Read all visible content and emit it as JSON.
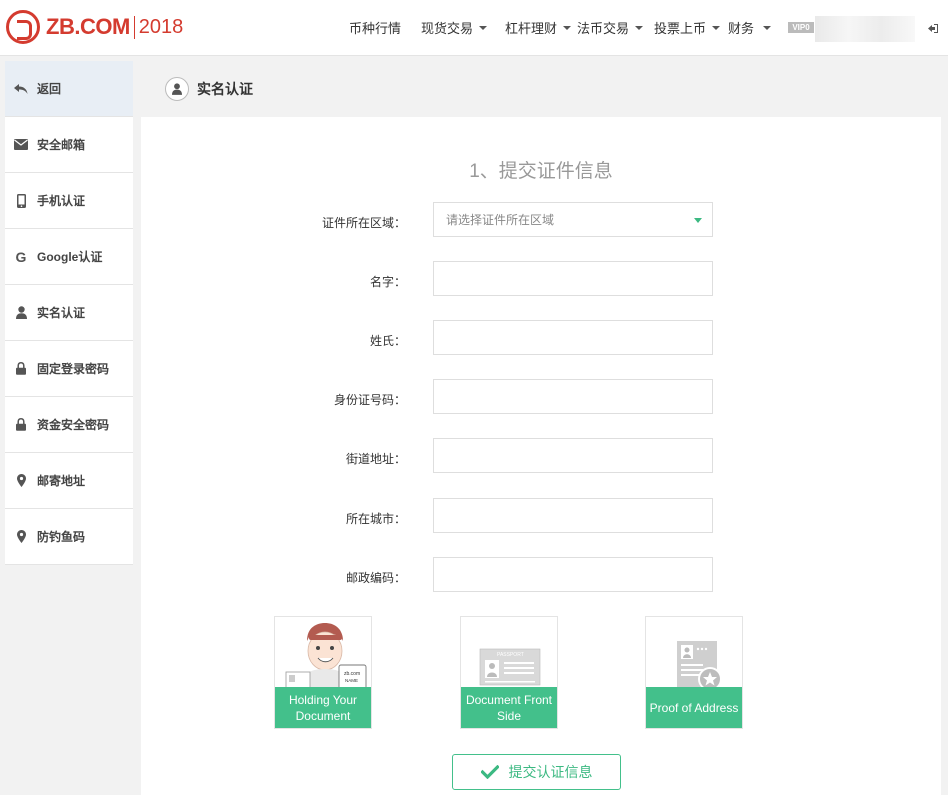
{
  "header": {
    "logo_text": "ZB.COM",
    "logo_year": "2018",
    "nav": [
      {
        "label": "币种行情",
        "dropdown": false
      },
      {
        "label": "现货交易",
        "dropdown": true
      },
      {
        "label": "杠杆理财",
        "dropdown": true
      },
      {
        "label": "法币交易",
        "dropdown": true
      },
      {
        "label": "投票上币",
        "dropdown": true
      },
      {
        "label": "财务",
        "dropdown": true
      }
    ],
    "vip_badge": "VIP0"
  },
  "sidebar": {
    "items": [
      {
        "label": "返回",
        "icon": "back-arrow-icon",
        "active": true
      },
      {
        "label": "安全邮箱",
        "icon": "envelope-icon"
      },
      {
        "label": "手机认证",
        "icon": "mobile-icon"
      },
      {
        "label": "Google认证",
        "icon": "google-icon"
      },
      {
        "label": "实名认证",
        "icon": "user-icon"
      },
      {
        "label": "固定登录密码",
        "icon": "lock-icon"
      },
      {
        "label": "资金安全密码",
        "icon": "lock-icon"
      },
      {
        "label": "邮寄地址",
        "icon": "map-marker-icon"
      },
      {
        "label": "防钓鱼码",
        "icon": "map-marker-icon"
      }
    ]
  },
  "page": {
    "title": "实名认证",
    "step_title": "1、提交证件信息"
  },
  "form": {
    "region_label": "证件所在区域：",
    "region_placeholder": "请选择证件所在区域",
    "fields": [
      {
        "label": "名字：",
        "value": ""
      },
      {
        "label": "姓氏：",
        "value": ""
      },
      {
        "label": "身份证号码：",
        "value": ""
      },
      {
        "label": "街道地址：",
        "value": ""
      },
      {
        "label": "所在城市：",
        "value": ""
      },
      {
        "label": "邮政编码：",
        "value": ""
      }
    ]
  },
  "uploads": [
    {
      "label": "Holding Your Document",
      "icon": "person-holding-document-icon",
      "card_text": "zb.com",
      "card_subtext": "NAME"
    },
    {
      "label": "Document Front Side",
      "icon": "passport-icon",
      "card_text": "PASSPORT"
    },
    {
      "label": "Proof of Address",
      "icon": "certificate-icon"
    }
  ],
  "submit_label": "提交认证信息",
  "colors": {
    "brand_red": "#d43b2f",
    "accent_green": "#43c08b"
  }
}
